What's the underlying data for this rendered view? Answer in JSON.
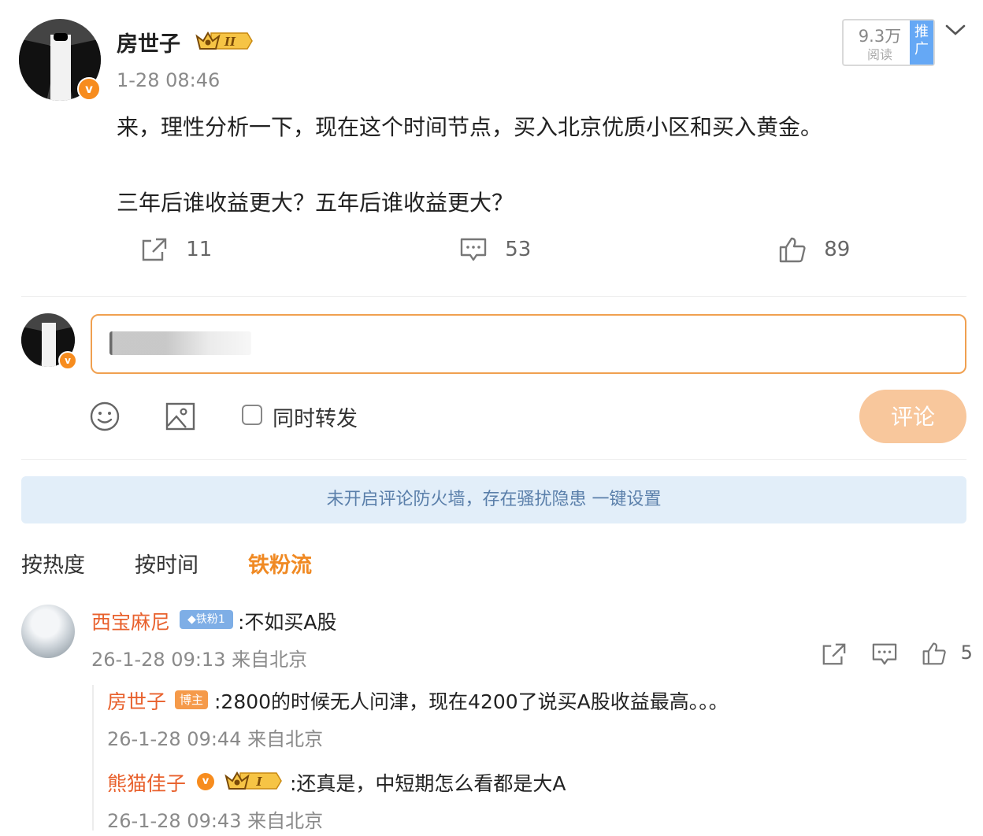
{
  "post": {
    "username": "房世子",
    "rank_badge_text": "II",
    "timestamp": "1-28 08:46",
    "line1": "来，理性分析一下，现在这个时间节点，买入北京优质小区和买入黄金。",
    "line2": "三年后谁收益更大？五年后谁收益更大？",
    "reads_count": "9.3万",
    "reads_label": "阅读",
    "promo_label": "推广",
    "repost_count": "11",
    "comment_count": "53",
    "like_count": "89"
  },
  "composer": {
    "repost_checkbox_label": "同时转发",
    "submit_label": "评论"
  },
  "notice": {
    "text": "未开启评论防火墙，存在骚扰隐患 一键设置"
  },
  "tabs": [
    {
      "label": "按热度",
      "active": false
    },
    {
      "label": "按时间",
      "active": false
    },
    {
      "label": "铁粉流",
      "active": true
    }
  ],
  "comments": [
    {
      "name": "西宝麻尼",
      "badge": "铁粉1",
      "text": ":不如买A股",
      "meta": "26-1-28 09:13 来自北京",
      "like_count": "5",
      "replies": [
        {
          "name": "房世子",
          "badge": "博主",
          "text": ":2800的时候无人问津，现在4200了说买A股收益最高。。。",
          "meta": "26-1-28 09:44 来自北京"
        },
        {
          "name": "熊猫佳子",
          "badge": "I",
          "text": ":还真是，中短期怎么看都是大A",
          "meta": "26-1-28 09:43 来自北京"
        }
      ]
    }
  ],
  "colors": {
    "accent_orange": "#f08a24",
    "name_orange": "#e8602c",
    "notice_bg": "#e2eef9",
    "notice_text": "#5a7faa",
    "submit_bg": "#f8c79c",
    "promo_blue": "#65a8f5"
  },
  "icons": {
    "repost": "share-icon",
    "comment": "comment-icon",
    "like": "thumbs-up-icon",
    "emoji": "emoji-icon",
    "image": "image-icon",
    "more": "chevron-down-icon",
    "verified": "verified-v-icon",
    "crown": "crown-icon",
    "diamond": "diamond-icon"
  }
}
